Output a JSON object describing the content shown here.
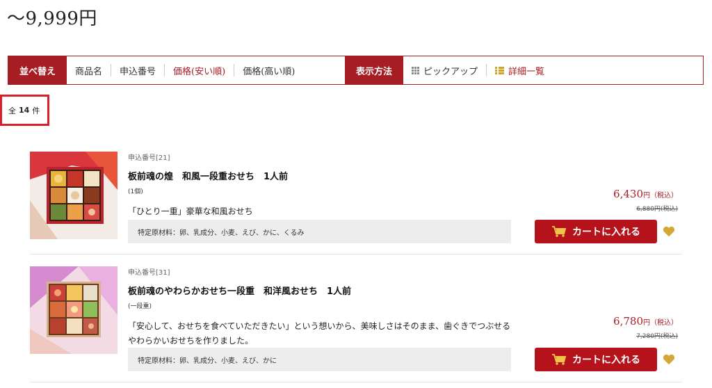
{
  "page": {
    "title": "～9,999円"
  },
  "sort": {
    "label": "並べ替え",
    "options": [
      "商品名",
      "申込番号",
      "価格(安い順)",
      "価格(高い順)"
    ],
    "active": "価格(安い順)"
  },
  "view": {
    "label": "表示方法",
    "options": [
      "ピックアップ",
      "詳細一覧"
    ],
    "active": "詳細一覧"
  },
  "result": {
    "prefix": "全",
    "count": "14",
    "suffix": "件"
  },
  "products": [
    {
      "code": "申込番号[21]",
      "name": "板前魂の煌　和風一段重おせち　1人前",
      "qty": "(1個)",
      "desc": "「ひとり一重」豪華な和風おせち",
      "allergen": "特定原材料：卵、乳成分、小麦、えび、かに、くるみ",
      "price": "6,430",
      "price_unit": "円（税込）",
      "was": "6,880円(税込)",
      "cart_label": "カートに入れる"
    },
    {
      "code": "申込番号[31]",
      "name": "板前魂のやわらかおせち一段重　和洋風おせち　1人前",
      "qty": "(一段重)",
      "desc": "「安心して、おせちを食べていただきたい」という想いから、美味しさはそのまま、歯ぐきでつぶせるやわらかいおせちを作りました。",
      "allergen": "特定原材料：卵、乳成分、小麦、えび、かに",
      "price": "6,780",
      "price_unit": "円（税込）",
      "was": "7,280円(税込)",
      "cart_label": "カートに入れる"
    }
  ],
  "colors": {
    "accent": "#a61d24",
    "cart": "#b5121b",
    "highlight": "#d9202a",
    "heart": "#d4a838"
  },
  "icons": {
    "cart": "cart-icon",
    "favorite": "heart-icon",
    "pickup": "grid-icon",
    "detail": "list-icon"
  }
}
